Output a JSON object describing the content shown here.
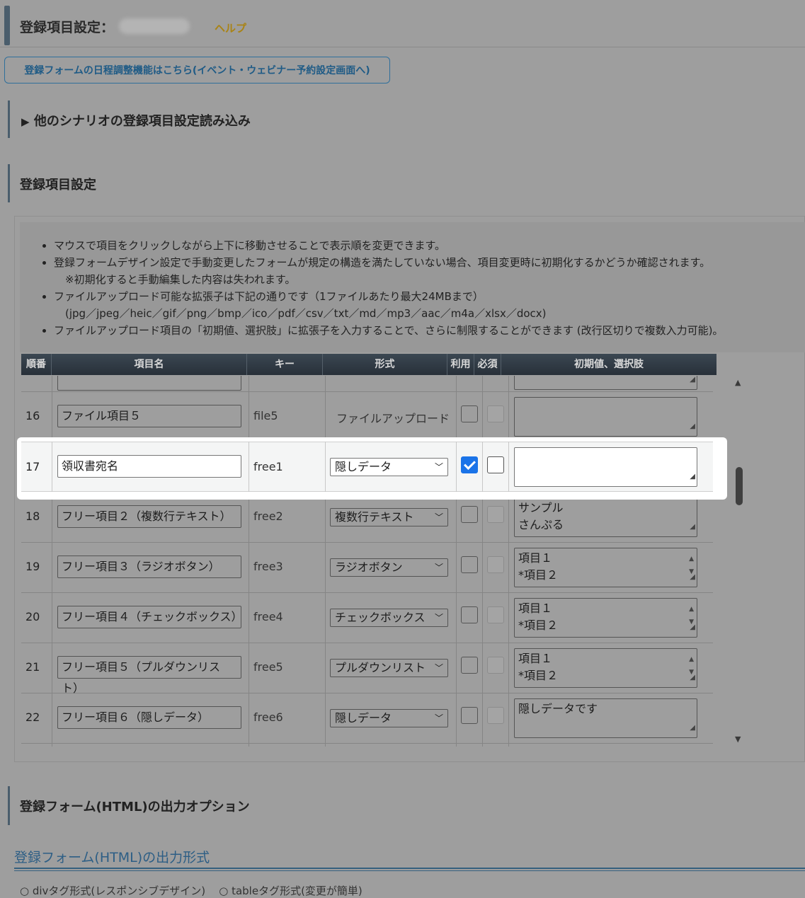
{
  "header": {
    "title": "登録項目設定：",
    "help": "ヘルプ"
  },
  "schedule_button": "登録フォームの日程調整機能はこちら(イベント・ウェビナー予約設定画面へ)",
  "load_section": {
    "arrow": "▶",
    "title": "他のシナリオの登録項目設定読み込み"
  },
  "settings_section": {
    "title": "登録項目設定"
  },
  "notes": [
    "マウスで項目をクリックしながら上下に移動させることで表示順を変更できます。",
    "登録フォームデザイン設定で手動変更したフォームが規定の構造を満たしていない場合、項目変更時に初期化するかどうか確認されます。",
    "※初期化すると手動編集した内容は失われます。",
    "ファイルアップロード可能な拡張子は下記の通りです（1ファイルあたり最大24MBまで）",
    "(jpg／jpeg／heic／gif／png／bmp／ico／pdf／csv／txt／md／mp3／aac／m4a／xlsx／docx)",
    "ファイルアップロード項目の「初期値、選択肢」に拡張子を入力することで、さらに制限することができます (改行区切りで複数入力可能)。"
  ],
  "table": {
    "headers": [
      "順番",
      "項目名",
      "キー",
      "形式",
      "利用",
      "必須",
      "初期値、選択肢"
    ],
    "rows": [
      {
        "num": "16",
        "name": "ファイル項目５",
        "key": "file5",
        "format": "ファイルアップロード",
        "format_is_select": false,
        "use": false,
        "required_disabled": true,
        "options": ""
      },
      {
        "num": "17",
        "name": "領収書宛名",
        "key": "free1",
        "format": "隠しデータ",
        "format_is_select": true,
        "use": true,
        "required_disabled": false,
        "options": ""
      },
      {
        "num": "18",
        "name": "フリー項目２（複数行テキスト）",
        "key": "free2",
        "format": "複数行テキスト",
        "format_is_select": true,
        "use": false,
        "required_disabled": true,
        "options": "サンプル\nさんぷる"
      },
      {
        "num": "19",
        "name": "フリー項目３（ラジオボタン）",
        "key": "free3",
        "format": "ラジオボタン",
        "format_is_select": true,
        "use": false,
        "required_disabled": true,
        "options": "項目１\n*項目２"
      },
      {
        "num": "20",
        "name": "フリー項目４（チェックボックス）",
        "key": "free4",
        "format": "チェックボックス",
        "format_is_select": true,
        "use": false,
        "required_disabled": true,
        "options": "項目１\n*項目２"
      },
      {
        "num": "21",
        "name": "フリー項目５（プルダウンリスト）",
        "key": "free5",
        "format": "プルダウンリスト",
        "format_is_select": true,
        "use": false,
        "required_disabled": true,
        "options": "項目１\n*項目２"
      },
      {
        "num": "22",
        "name": "フリー項目６（隠しデータ）",
        "key": "free6",
        "format": "隠しデータ",
        "format_is_select": true,
        "use": false,
        "required_disabled": true,
        "options": "隠しデータです"
      }
    ]
  },
  "output_section": {
    "title": "登録フォーム(HTML)の出力オプション",
    "subtitle": "登録フォーム(HTML)の出力形式",
    "radio_1": "divタグ形式(レスポンシブデザイン)",
    "radio_2": "tableタグ形式(変更が簡単)"
  }
}
